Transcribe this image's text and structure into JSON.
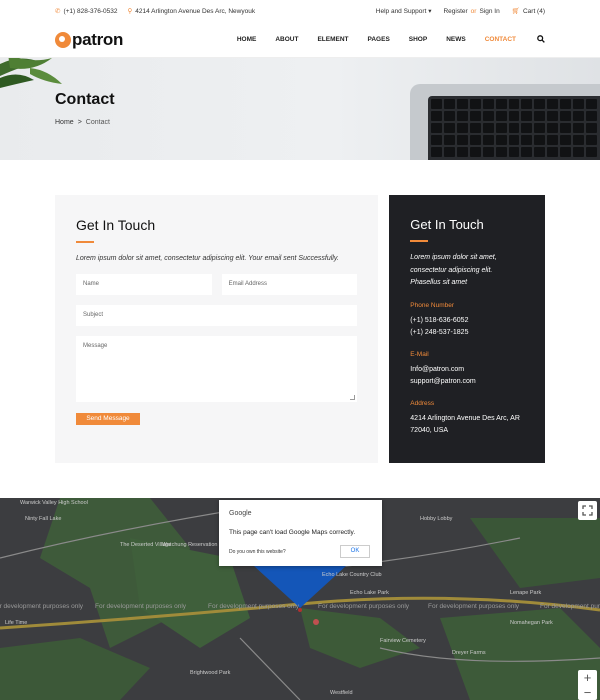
{
  "topbar": {
    "phone": "(+1) 828-376-0532",
    "address": "4214 Arlington Avenue Des Arc, Newyouk",
    "help": "Help and Support",
    "register": "Register",
    "or": "or",
    "signin": "Sign In",
    "cart": "Cart (4)"
  },
  "brand": {
    "logo_text": "patron"
  },
  "nav": {
    "items": [
      "HOME",
      "ABOUT",
      "ELEMENT",
      "PAGES",
      "SHOP",
      "NEWS",
      "CONTACT"
    ]
  },
  "hero": {
    "title": "Contact",
    "breadcrumb_home": "Home",
    "breadcrumb_sep": ">",
    "breadcrumb_current": "Contact"
  },
  "form": {
    "title": "Get In Touch",
    "lead": "Lorem ipsum dolor sit amet, consectetur adipiscing elit. Your email sent Successfully.",
    "name_placeholder": "Name",
    "email_placeholder": "Email Address",
    "subject_placeholder": "Subject",
    "message_placeholder": "Message",
    "send_label": "Send Message"
  },
  "info": {
    "title": "Get In Touch",
    "lead": "Lorem ipsum dolor sit amet, consectetur adipiscing elit. Phasellus sit amet",
    "phone_label": "Phone Number",
    "phone_1": "(+1) 518-636-6052",
    "phone_2": "(+1) 248-537-1825",
    "email_label": "E-Mail",
    "email_1": "Info@patron.com",
    "email_2": "support@patron.com",
    "address_label": "Address",
    "address": "4214 Arlington Avenue Des Arc, AR 72040, USA"
  },
  "map": {
    "dev_text": "For development purposes only",
    "dialog_brand": "Google",
    "dialog_message": "This page can't load Google Maps correctly.",
    "dialog_own": "Do you own this website?",
    "dialog_ok": "OK",
    "zoom_in": "+",
    "zoom_out": "−",
    "labels": [
      "Warwick Valley High School",
      "Ninty Fall Lake",
      "The Deserted Village",
      "Watchung Reservation",
      "Echo Lake Park",
      "Fairview Cemetery",
      "Hobby Lobby",
      "Lenape Park",
      "Nomahegan Park",
      "Life Time",
      "Brightwood Park",
      "Westfield",
      "Echo Lake Country Club",
      "Dreyer Farms"
    ]
  },
  "colors": {
    "accent": "#f08a3a",
    "dark_panel": "#1f2024",
    "map_bg": "#3c3d40"
  }
}
